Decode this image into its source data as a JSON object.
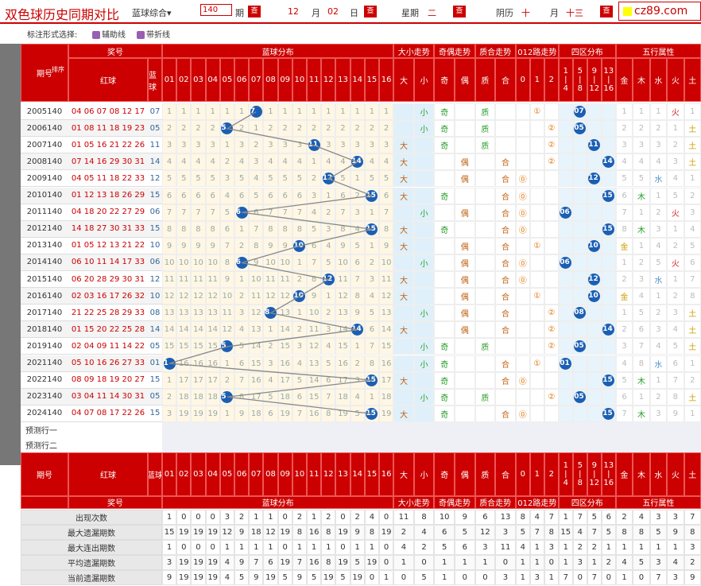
{
  "toolbar": {
    "title": "双色球历史同期对比",
    "mode": "蓝球综合",
    "mode_arrow": "▾",
    "periods": "140",
    "period_unit": "期",
    "month": "12",
    "month_unit": "月",
    "day": "02",
    "day_unit": "日",
    "week_label": "星期",
    "week": "二",
    "lunar_label": "阴历",
    "lunar_day1": "十",
    "lunar_month_unit": "月",
    "lunar_day2": "十三",
    "query": "查",
    "logo": "cz89.com"
  },
  "options": {
    "label": "标注形式选择:",
    "opt1": "辅助线",
    "opt2": "带折线"
  },
  "headers": {
    "issue": "期号",
    "sort": "排序",
    "prize": "奖号",
    "red": "红球",
    "blue": "蓝球",
    "blue_dist": "蓝球分布",
    "size": "大小走势",
    "odd": "奇偶走势",
    "prime": "质合走势",
    "mod": "012路走势",
    "zone": "四区分布",
    "wuxing": "五行属性",
    "big": "大",
    "small": "小",
    "odd1": "奇",
    "even": "偶",
    "prime1": "质",
    "comp": "合",
    "m0": "0",
    "m1": "1",
    "m2": "2",
    "z1": "1",
    "z1b": "4",
    "z2": "5",
    "z2b": "8",
    "z3": "9",
    "z3b": "12",
    "z4": "13",
    "z4b": "16",
    "wx": [
      "金",
      "木",
      "水",
      "火",
      "土"
    ]
  },
  "nums": [
    "01",
    "02",
    "03",
    "04",
    "05",
    "06",
    "07",
    "08",
    "09",
    "10",
    "11",
    "12",
    "13",
    "14",
    "15",
    "16"
  ],
  "rows": [
    {
      "issue": "2005140",
      "red": "04 06 07 08 12 17",
      "blue": "07",
      "cells": [
        "1",
        "1",
        "1",
        "1",
        "1",
        "1",
        "7",
        "1",
        "1",
        "1",
        "1",
        "1",
        "1",
        "1",
        "1",
        "1"
      ],
      "size": [
        "",
        "小"
      ],
      "odd": [
        "奇",
        ""
      ],
      "prime": [
        "质",
        ""
      ],
      "mod": [
        "",
        "①",
        ""
      ],
      "zone": [
        "",
        "07",
        "",
        ""
      ],
      "wx": [
        "1",
        "1",
        "1",
        "火",
        "1"
      ]
    },
    {
      "issue": "2006140",
      "red": "01 08 11 18 19 23",
      "blue": "05",
      "cells": [
        "2",
        "2",
        "2",
        "2",
        "5",
        "2",
        "1",
        "2",
        "2",
        "2",
        "2",
        "2",
        "2",
        "2",
        "2",
        "2"
      ],
      "size": [
        "",
        "小"
      ],
      "odd": [
        "奇",
        ""
      ],
      "prime": [
        "质",
        ""
      ],
      "mod": [
        "",
        "",
        "②"
      ],
      "zone": [
        "",
        "05",
        "",
        ""
      ],
      "wx": [
        "2",
        "2",
        "2",
        "1",
        "土"
      ]
    },
    {
      "issue": "2007140",
      "red": "01 05 16 21 22 26",
      "blue": "11",
      "cells": [
        "3",
        "3",
        "3",
        "3",
        "1",
        "3",
        "2",
        "3",
        "3",
        "3",
        "11",
        "3",
        "3",
        "3",
        "3",
        "3"
      ],
      "size": [
        "大",
        ""
      ],
      "odd": [
        "奇",
        ""
      ],
      "prime": [
        "质",
        ""
      ],
      "mod": [
        "",
        "",
        "②"
      ],
      "zone": [
        "",
        "",
        "11",
        ""
      ],
      "wx": [
        "3",
        "3",
        "3",
        "2",
        "土"
      ]
    },
    {
      "issue": "2008140",
      "red": "07 14 16 29 30 31",
      "blue": "14",
      "cells": [
        "4",
        "4",
        "4",
        "4",
        "2",
        "4",
        "3",
        "4",
        "4",
        "4",
        "1",
        "4",
        "4",
        "14",
        "4",
        "4"
      ],
      "size": [
        "大",
        ""
      ],
      "odd": [
        "",
        "偶"
      ],
      "prime": [
        "",
        "合"
      ],
      "mod": [
        "",
        "",
        "②"
      ],
      "zone": [
        "",
        "",
        "",
        "14"
      ],
      "wx": [
        "4",
        "4",
        "4",
        "3",
        "土"
      ]
    },
    {
      "issue": "2009140",
      "red": "04 05 11 18 22 33",
      "blue": "12",
      "cells": [
        "5",
        "5",
        "5",
        "5",
        "3",
        "5",
        "4",
        "5",
        "5",
        "5",
        "2",
        "12",
        "5",
        "1",
        "5",
        "5"
      ],
      "size": [
        "大",
        ""
      ],
      "odd": [
        "",
        "偶"
      ],
      "prime": [
        "",
        "合"
      ],
      "mod": [
        "⓪",
        "",
        ""
      ],
      "zone": [
        "",
        "",
        "12",
        ""
      ],
      "wx": [
        "5",
        "5",
        "水",
        "4",
        "1"
      ]
    },
    {
      "issue": "2010140",
      "red": "01 12 13 18 26 29",
      "blue": "15",
      "cells": [
        "6",
        "6",
        "6",
        "6",
        "4",
        "6",
        "5",
        "6",
        "6",
        "6",
        "3",
        "1",
        "6",
        "2",
        "15",
        "6"
      ],
      "size": [
        "大",
        ""
      ],
      "odd": [
        "奇",
        ""
      ],
      "prime": [
        "",
        "合"
      ],
      "mod": [
        "⓪",
        "",
        ""
      ],
      "zone": [
        "",
        "",
        "",
        "15"
      ],
      "wx": [
        "6",
        "木",
        "1",
        "5",
        "2"
      ]
    },
    {
      "issue": "2011140",
      "red": "04 18 20 22 27 29",
      "blue": "06",
      "cells": [
        "7",
        "7",
        "7",
        "7",
        "5",
        "6",
        "6",
        "7",
        "7",
        "7",
        "4",
        "2",
        "7",
        "3",
        "1",
        "7"
      ],
      "size": [
        "",
        "小"
      ],
      "odd": [
        "",
        "偶"
      ],
      "prime": [
        "",
        "合"
      ],
      "mod": [
        "⓪",
        "",
        ""
      ],
      "zone": [
        "06",
        "",
        "",
        ""
      ],
      "wx": [
        "7",
        "1",
        "2",
        "火",
        "3"
      ]
    },
    {
      "issue": "2012140",
      "red": "14 18 27 30 31 33",
      "blue": "15",
      "cells": [
        "8",
        "8",
        "8",
        "8",
        "6",
        "1",
        "7",
        "8",
        "8",
        "8",
        "5",
        "3",
        "8",
        "4",
        "15",
        "8"
      ],
      "size": [
        "大",
        ""
      ],
      "odd": [
        "奇",
        ""
      ],
      "prime": [
        "",
        "合"
      ],
      "mod": [
        "⓪",
        "",
        ""
      ],
      "zone": [
        "",
        "",
        "",
        "15"
      ],
      "wx": [
        "8",
        "木",
        "3",
        "1",
        "4"
      ]
    },
    {
      "issue": "2013140",
      "red": "01 05 12 13 21 22",
      "blue": "10",
      "cells": [
        "9",
        "9",
        "9",
        "9",
        "7",
        "2",
        "8",
        "9",
        "9",
        "10",
        "6",
        "4",
        "9",
        "5",
        "1",
        "9"
      ],
      "size": [
        "大",
        ""
      ],
      "odd": [
        "",
        "偶"
      ],
      "prime": [
        "",
        "合"
      ],
      "mod": [
        "",
        "①",
        ""
      ],
      "zone": [
        "",
        "",
        "10",
        ""
      ],
      "wx": [
        "金",
        "1",
        "4",
        "2",
        "5"
      ]
    },
    {
      "issue": "2014140",
      "red": "06 10 11 14 17 33",
      "blue": "06",
      "cells": [
        "10",
        "10",
        "10",
        "10",
        "8",
        "6",
        "9",
        "10",
        "10",
        "1",
        "7",
        "5",
        "10",
        "6",
        "2",
        "10"
      ],
      "size": [
        "",
        "小"
      ],
      "odd": [
        "",
        "偶"
      ],
      "prime": [
        "",
        "合"
      ],
      "mod": [
        "⓪",
        "",
        ""
      ],
      "zone": [
        "06",
        "",
        "",
        ""
      ],
      "wx": [
        "1",
        "2",
        "5",
        "火",
        "6"
      ]
    },
    {
      "issue": "2015140",
      "red": "06 20 28 29 30 31",
      "blue": "12",
      "cells": [
        "11",
        "11",
        "11",
        "11",
        "9",
        "1",
        "10",
        "11",
        "11",
        "2",
        "8",
        "12",
        "11",
        "7",
        "3",
        "11"
      ],
      "size": [
        "大",
        ""
      ],
      "odd": [
        "",
        "偶"
      ],
      "prime": [
        "",
        "合"
      ],
      "mod": [
        "⓪",
        "",
        ""
      ],
      "zone": [
        "",
        "",
        "12",
        ""
      ],
      "wx": [
        "2",
        "3",
        "水",
        "1",
        "7"
      ]
    },
    {
      "issue": "2016140",
      "red": "02 03 16 17 26 32",
      "blue": "10",
      "cells": [
        "12",
        "12",
        "12",
        "12",
        "10",
        "2",
        "11",
        "12",
        "12",
        "10",
        "9",
        "1",
        "12",
        "8",
        "4",
        "12"
      ],
      "size": [
        "大",
        ""
      ],
      "odd": [
        "",
        "偶"
      ],
      "prime": [
        "",
        "合"
      ],
      "mod": [
        "",
        "①",
        ""
      ],
      "zone": [
        "",
        "",
        "10",
        ""
      ],
      "wx": [
        "金",
        "4",
        "1",
        "2",
        "8"
      ]
    },
    {
      "issue": "2017140",
      "red": "21 22 25 28 29 33",
      "blue": "08",
      "cells": [
        "13",
        "13",
        "13",
        "13",
        "11",
        "3",
        "12",
        "8",
        "13",
        "1",
        "10",
        "2",
        "13",
        "9",
        "5",
        "13"
      ],
      "size": [
        "",
        "小"
      ],
      "odd": [
        "",
        "偶"
      ],
      "prime": [
        "",
        "合"
      ],
      "mod": [
        "",
        "",
        "②"
      ],
      "zone": [
        "",
        "08",
        "",
        ""
      ],
      "wx": [
        "1",
        "5",
        "2",
        "3",
        "土"
      ]
    },
    {
      "issue": "2018140",
      "red": "01 15 20 22 25 28",
      "blue": "14",
      "cells": [
        "14",
        "14",
        "14",
        "14",
        "12",
        "4",
        "13",
        "1",
        "14",
        "2",
        "11",
        "3",
        "14",
        "14",
        "6",
        "14"
      ],
      "size": [
        "大",
        ""
      ],
      "odd": [
        "",
        "偶"
      ],
      "prime": [
        "",
        "合"
      ],
      "mod": [
        "",
        "",
        "②"
      ],
      "zone": [
        "",
        "",
        "",
        "14"
      ],
      "wx": [
        "2",
        "6",
        "3",
        "4",
        "土"
      ]
    },
    {
      "issue": "2019140",
      "red": "02 04 09 11 14 22",
      "blue": "05",
      "cells": [
        "15",
        "15",
        "15",
        "15",
        "5",
        "5",
        "14",
        "2",
        "15",
        "3",
        "12",
        "4",
        "15",
        "1",
        "7",
        "15"
      ],
      "size": [
        "",
        "小"
      ],
      "odd": [
        "奇",
        ""
      ],
      "prime": [
        "质",
        ""
      ],
      "mod": [
        "",
        "",
        "②"
      ],
      "zone": [
        "",
        "05",
        "",
        ""
      ],
      "wx": [
        "3",
        "7",
        "4",
        "5",
        "土"
      ]
    },
    {
      "issue": "2021140",
      "red": "05 10 16 26 27 33",
      "blue": "01",
      "cells": [
        "1",
        "16",
        "16",
        "16",
        "1",
        "6",
        "15",
        "3",
        "16",
        "4",
        "13",
        "5",
        "16",
        "2",
        "8",
        "16"
      ],
      "size": [
        "",
        "小"
      ],
      "odd": [
        "奇",
        ""
      ],
      "prime": [
        "",
        "合"
      ],
      "mod": [
        "",
        "①",
        ""
      ],
      "zone": [
        "01",
        "",
        "",
        ""
      ],
      "wx": [
        "4",
        "8",
        "水",
        "6",
        "1"
      ]
    },
    {
      "issue": "2022140",
      "red": "08 09 18 19 20 27",
      "blue": "15",
      "cells": [
        "1",
        "17",
        "17",
        "17",
        "2",
        "7",
        "16",
        "4",
        "17",
        "5",
        "14",
        "6",
        "17",
        "3",
        "15",
        "17"
      ],
      "size": [
        "大",
        ""
      ],
      "odd": [
        "奇",
        ""
      ],
      "prime": [
        "",
        "合"
      ],
      "mod": [
        "⓪",
        "",
        ""
      ],
      "zone": [
        "",
        "",
        "",
        "15"
      ],
      "wx": [
        "5",
        "木",
        "1",
        "7",
        "2"
      ]
    },
    {
      "issue": "2023140",
      "red": "03 04 11 14 30 31",
      "blue": "05",
      "cells": [
        "2",
        "18",
        "18",
        "18",
        "5",
        "8",
        "17",
        "5",
        "18",
        "6",
        "15",
        "7",
        "18",
        "4",
        "1",
        "18"
      ],
      "size": [
        "",
        "小"
      ],
      "odd": [
        "奇",
        ""
      ],
      "prime": [
        "质",
        ""
      ],
      "mod": [
        "",
        "",
        "②"
      ],
      "zone": [
        "",
        "05",
        "",
        ""
      ],
      "wx": [
        "6",
        "1",
        "2",
        "8",
        "土"
      ]
    },
    {
      "issue": "2024140",
      "red": "04 07 08 17 22 26",
      "blue": "15",
      "cells": [
        "3",
        "19",
        "19",
        "19",
        "1",
        "9",
        "18",
        "6",
        "19",
        "7",
        "16",
        "8",
        "19",
        "5",
        "15",
        "19"
      ],
      "size": [
        "大",
        ""
      ],
      "odd": [
        "奇",
        ""
      ],
      "prime": [
        "",
        "合"
      ],
      "mod": [
        "⓪",
        "",
        ""
      ],
      "zone": [
        "",
        "",
        "",
        "15"
      ],
      "wx": [
        "7",
        "木",
        "3",
        "9",
        "1"
      ]
    }
  ],
  "predict": {
    "row1": "预测行一",
    "row2": "预测行二"
  },
  "stats": [
    {
      "label": "出现次数",
      "vals": [
        "1",
        "0",
        "0",
        "0",
        "3",
        "2",
        "1",
        "1",
        "0",
        "2",
        "1",
        "2",
        "0",
        "2",
        "4",
        "0",
        "11",
        "8",
        "10",
        "9",
        "6",
        "13",
        "8",
        "4",
        "7",
        "1",
        "7",
        "5",
        "6",
        "2",
        "4",
        "3",
        "3",
        "7"
      ]
    },
    {
      "label": "最大遗漏期数",
      "vals": [
        "15",
        "19",
        "19",
        "19",
        "12",
        "9",
        "18",
        "12",
        "19",
        "8",
        "16",
        "8",
        "19",
        "9",
        "8",
        "19",
        "2",
        "4",
        "6",
        "5",
        "12",
        "3",
        "5",
        "7",
        "8",
        "15",
        "4",
        "7",
        "5",
        "8",
        "8",
        "5",
        "9",
        "8"
      ]
    },
    {
      "label": "最大连出期数",
      "vals": [
        "1",
        "0",
        "0",
        "0",
        "1",
        "1",
        "1",
        "1",
        "0",
        "1",
        "1",
        "1",
        "0",
        "1",
        "1",
        "0",
        "4",
        "2",
        "5",
        "6",
        "3",
        "11",
        "4",
        "1",
        "3",
        "1",
        "2",
        "2",
        "1",
        "1",
        "1",
        "1",
        "1",
        "3"
      ]
    },
    {
      "label": "平均遗漏期数",
      "vals": [
        "3",
        "19",
        "19",
        "19",
        "4",
        "9",
        "7",
        "6",
        "19",
        "7",
        "16",
        "8",
        "19",
        "5",
        "19",
        "0",
        "1",
        "0",
        "1",
        "1",
        "1",
        "0",
        "1",
        "1",
        "0",
        "1",
        "3",
        "1",
        "2",
        "4",
        "5",
        "3",
        "4",
        "2"
      ]
    },
    {
      "label": "当前遗漏期数",
      "vals": [
        "9",
        "19",
        "19",
        "19",
        "4",
        "5",
        "9",
        "19",
        "5",
        "9",
        "5",
        "19",
        "5",
        "19",
        "0",
        "1",
        "0",
        "5",
        "1",
        "0",
        "0",
        "3",
        "1",
        "3",
        "1",
        "7",
        "0",
        "7",
        "0",
        "1",
        "0",
        "7",
        "3",
        "9"
      ]
    }
  ]
}
